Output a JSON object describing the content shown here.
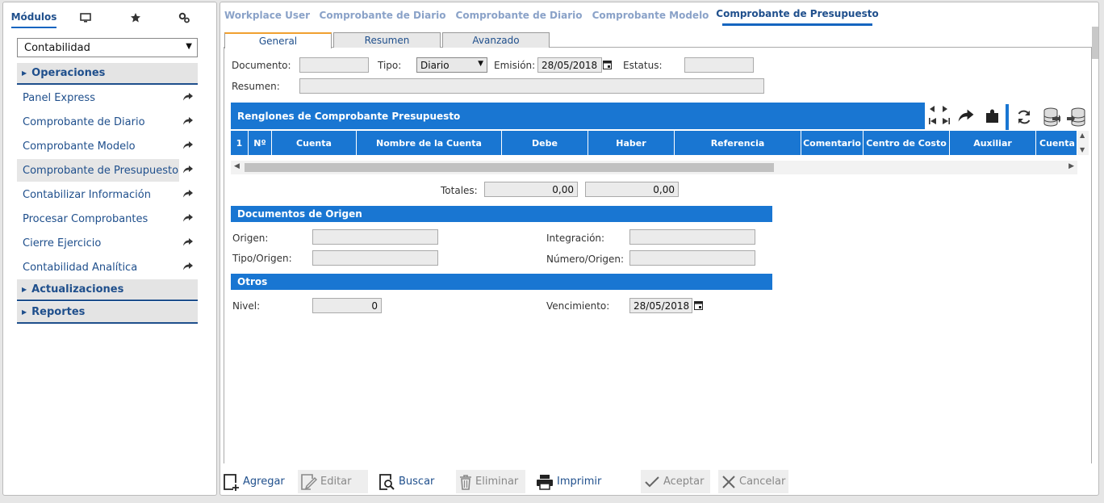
{
  "sidebar": {
    "tabs": [
      {
        "label": "Módulos",
        "icon": null
      },
      {
        "label": "",
        "icon": "monitor-icon"
      },
      {
        "label": "",
        "icon": "star-icon"
      },
      {
        "label": "",
        "icon": "gears-icon"
      }
    ],
    "module_select": "Contabilidad",
    "groups": {
      "operaciones": "Operaciones",
      "actualizaciones": "Actualizaciones",
      "reportes": "Reportes"
    },
    "items": [
      "Panel Express",
      "Comprobante de Diario",
      "Comprobante Modelo",
      "Comprobante de Presupuesto",
      "Contabilizar Información",
      "Procesar Comprobantes",
      "Cierre Ejercicio",
      "Contabilidad Analítica"
    ]
  },
  "top_tabs": [
    "Workplace User",
    "Comprobante de Diario",
    "Comprobante de Diario",
    "Comprobante Modelo",
    "Comprobante de Presupuesto"
  ],
  "form_tabs": [
    "General",
    "Resumen",
    "Avanzado"
  ],
  "form": {
    "documento_label": "Documento:",
    "documento_value": "",
    "tipo_label": "Tipo:",
    "tipo_value": "Diario",
    "emision_label": "Emisión:",
    "emision_value": "28/05/2018",
    "estatus_label": "Estatus:",
    "estatus_value": "",
    "resumen_label": "Resumen:",
    "resumen_value": ""
  },
  "grid": {
    "title": "Renglones de Comprobante Presupuesto",
    "columns": [
      "1",
      "Nº",
      "Cuenta",
      "Nombre de la Cuenta",
      "Debe",
      "Haber",
      "Referencia",
      "Comentario",
      "Centro de Costo",
      "Auxiliar",
      "Cuenta de"
    ]
  },
  "totals": {
    "label": "Totales:",
    "debe": "0,00",
    "haber": "0,00"
  },
  "origen": {
    "title": "Documentos de Origen",
    "origen_label": "Origen:",
    "tipo_origen_label": "Tipo/Origen:",
    "integracion_label": "Integración:",
    "numero_origen_label": "Número/Origen:"
  },
  "otros": {
    "title": "Otros",
    "nivel_label": "Nivel:",
    "nivel_value": "0",
    "vencimiento_label": "Vencimiento:",
    "vencimiento_value": "28/05/2018"
  },
  "toolbar": {
    "agregar": "Agregar",
    "editar": "Editar",
    "buscar": "Buscar",
    "eliminar": "Eliminar",
    "imprimir": "Imprimir",
    "aceptar": "Aceptar",
    "cancelar": "Cancelar"
  },
  "colors": {
    "accent": "#1976d2",
    "nav_text": "#1f4f8c",
    "tab_inactive": "#8aa2c8",
    "active_tab_border": "#f0a030"
  }
}
